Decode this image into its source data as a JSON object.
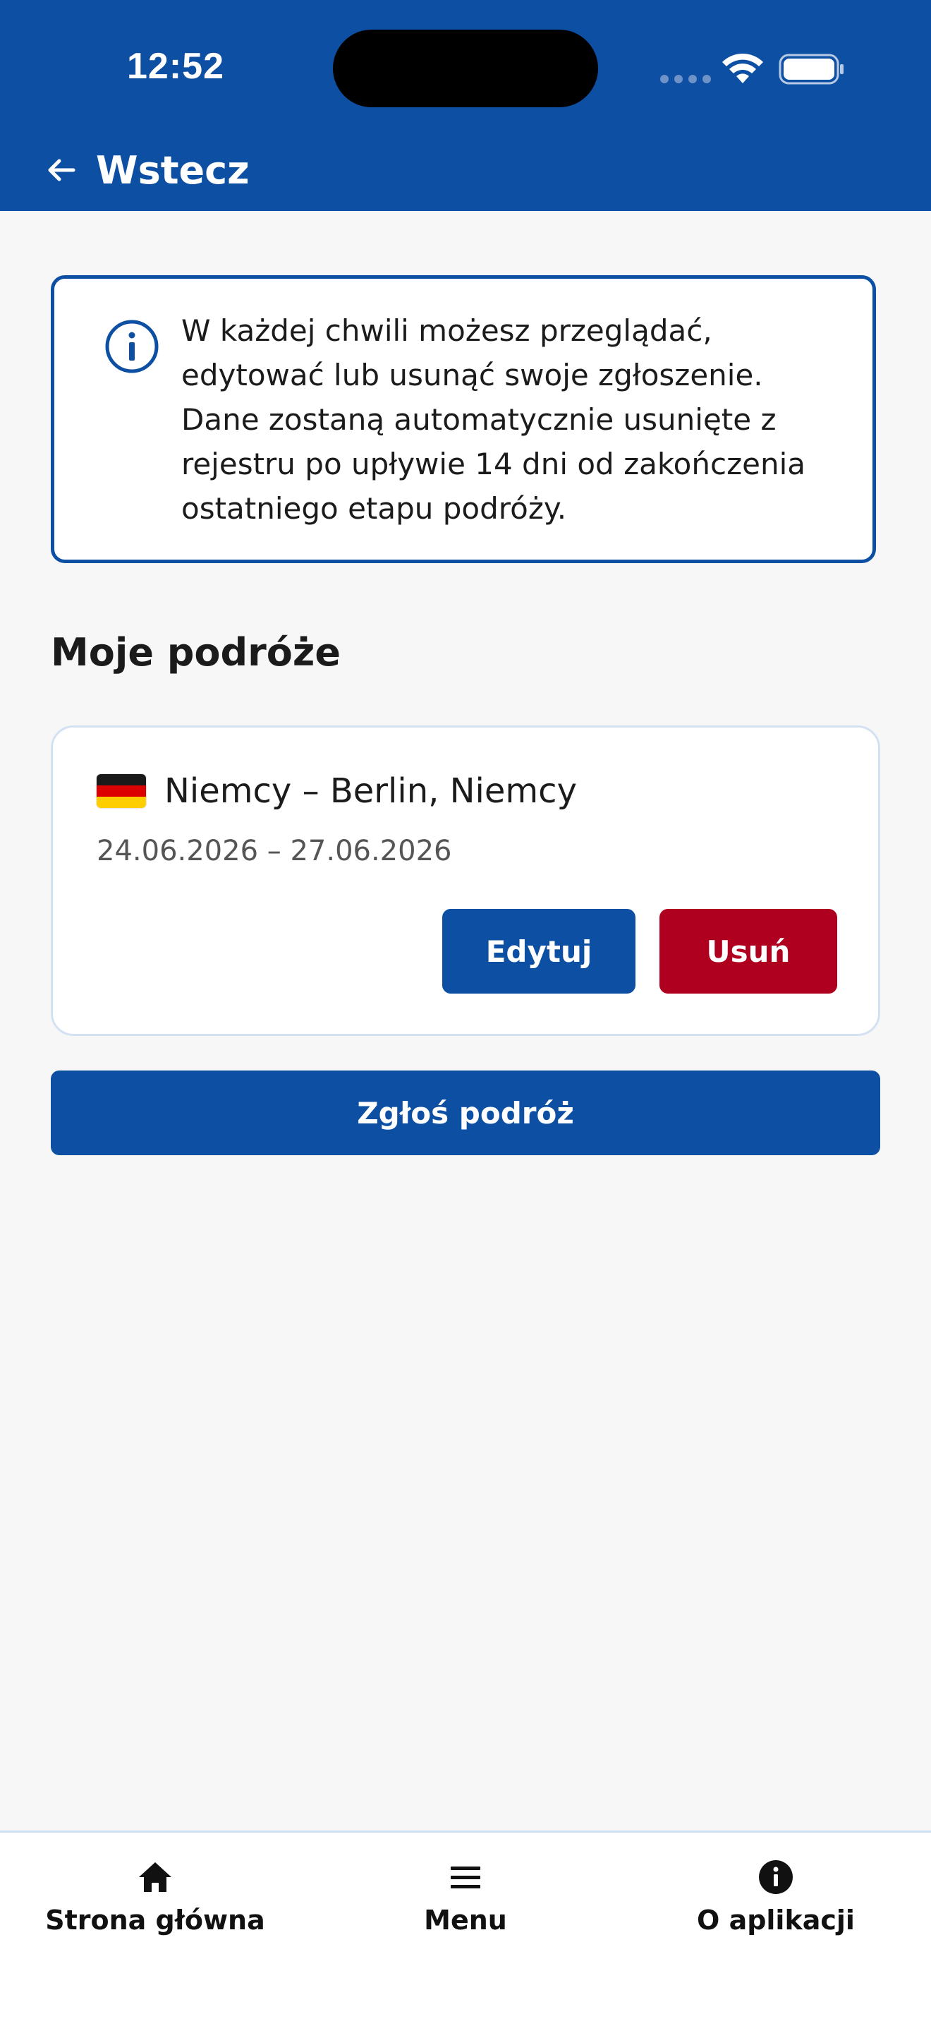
{
  "status_bar": {
    "time": "12:52"
  },
  "header": {
    "back_label": "Wstecz",
    "background_color": "#0d4fa3"
  },
  "info_box": {
    "icon": "info-circle-icon",
    "text": "W każdej chwili możesz przeglądać, edytować lub usunąć swoje zgłoszenie.\nDane zostaną automatycznie usunięte z rejestru po upływie 14 dni od zakończenia ostatniego etapu podróży."
  },
  "section": {
    "title": "Moje podróże"
  },
  "trips": [
    {
      "flag": "germany-flag-icon",
      "title": "Niemcy – Berlin, Niemcy",
      "dates": "24.06.2026 – 27.06.2026",
      "edit_label": "Edytuj",
      "delete_label": "Usuń"
    }
  ],
  "report_button": {
    "label": "Zgłoś podróż"
  },
  "bottom_nav": {
    "items": [
      {
        "icon": "home-icon",
        "label": "Strona główna"
      },
      {
        "icon": "menu-icon",
        "label": "Menu"
      },
      {
        "icon": "info-icon",
        "label": "O aplikacji"
      }
    ]
  },
  "colors": {
    "primary": "#0d4fa3",
    "danger": "#b0001f",
    "background": "#f7f7f7"
  }
}
